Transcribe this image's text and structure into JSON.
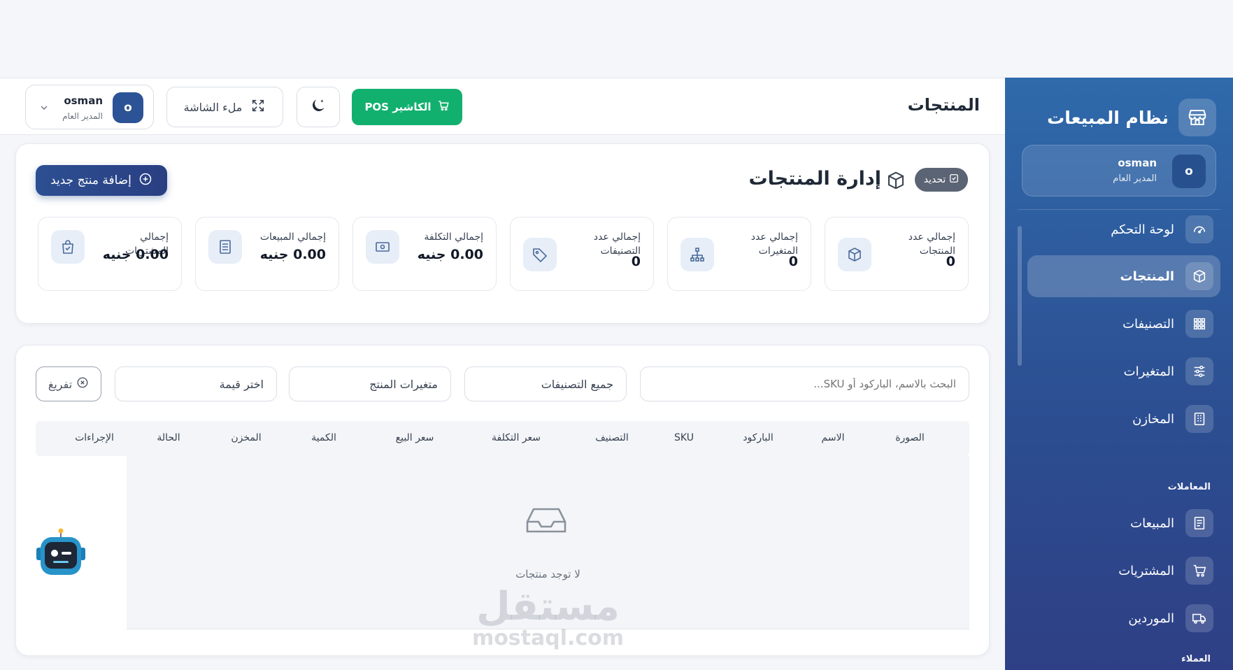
{
  "sidebar": {
    "brand_title": "نظام المبيعات",
    "user": {
      "initial": "o",
      "name": "osman",
      "role": "المدير العام"
    },
    "items": [
      {
        "label": "لوحة التحكم",
        "icon": "gauge-icon"
      },
      {
        "label": "المنتجات",
        "icon": "box-icon",
        "active": true
      },
      {
        "label": "التصنيفات",
        "icon": "grid-icon"
      },
      {
        "label": "المتغيرات",
        "icon": "sliders-icon"
      },
      {
        "label": "المخازن",
        "icon": "building-icon"
      },
      {
        "label": "المبيعات",
        "icon": "receipt-icon"
      },
      {
        "label": "المشتريات",
        "icon": "cart-icon"
      },
      {
        "label": "الموردين",
        "icon": "truck-icon"
      }
    ],
    "sections": {
      "transactions": "المعاملات",
      "customers": "العملاء"
    }
  },
  "header": {
    "page_title": "المنتجات",
    "pos_label": "الكاشير POS",
    "fullscreen_label": "ملء الشاشة",
    "user": {
      "initial": "o",
      "name": "osman",
      "role": "المدير العام"
    }
  },
  "summary": {
    "title": "إدارة المنتجات",
    "refresh_label": "تحديد",
    "add_label": "إضافة منتج جديد",
    "stats": [
      {
        "label": "إجمالي عدد المنتجات",
        "value": "0"
      },
      {
        "label": "إجمالي عدد المتغيرات",
        "value": "0"
      },
      {
        "label": "إجمالي عدد التصنيفات",
        "value": "0"
      },
      {
        "label": "إجمالي التكلفة",
        "value": "0.00 جنيه"
      },
      {
        "label": "إجمالي المبيعات",
        "value": "0.00 جنيه"
      },
      {
        "label": "إجمالي المشتريات",
        "value": "0.00 جنيه"
      }
    ]
  },
  "filters": {
    "search_placeholder": "البحث بالاسم، الباركود أو SKU...",
    "category": "جميع التصنيفات",
    "variants": "متغيرات المنتج",
    "value": "اختر قيمة",
    "clear_label": "تفريغ"
  },
  "table": {
    "columns": [
      "الصورة",
      "الاسم",
      "الباركود",
      "SKU",
      "التصنيف",
      "سعر التكلفة",
      "سعر البيع",
      "الكمية",
      "المخزن",
      "الحالة",
      "الإجراءات"
    ],
    "empty_text": "لا توجد منتجات"
  },
  "watermark": {
    "arabic": "مستقل",
    "latin": "mostaql.com"
  },
  "colors": {
    "primary": "#2c4f92",
    "pos_green": "#12b06e",
    "sidebar_top": "#2f6aab"
  }
}
